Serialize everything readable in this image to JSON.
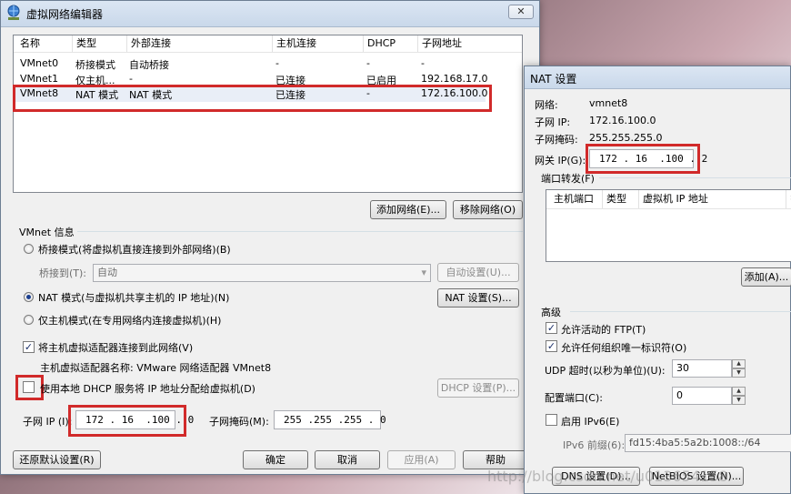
{
  "vne": {
    "title": "虚拟网络编辑器",
    "close_glyph": "✕",
    "headers": [
      "名称",
      "类型",
      "外部连接",
      "主机连接",
      "DHCP",
      "子网地址"
    ],
    "rows": [
      {
        "name": "VMnet0",
        "type": "桥接模式",
        "ext": "自动桥接",
        "host": "-",
        "dhcp": "-",
        "subnet": "-"
      },
      {
        "name": "VMnet1",
        "type": "仅主机...",
        "ext": "-",
        "host": "已连接",
        "dhcp": "已启用",
        "subnet": "192.168.17.0"
      },
      {
        "name": "VMnet8",
        "type": "NAT 模式",
        "ext": "NAT 模式",
        "host": "已连接",
        "dhcp": "-",
        "subnet": "172.16.100.0"
      }
    ],
    "add_network": "添加网络(E)...",
    "remove_network": "移除网络(O)",
    "vmnet_info": "VMnet 信息",
    "bridge_mode": "桥接模式(将虚拟机直接连接到外部网络)(B)",
    "bridge_to_label": "桥接到(T):",
    "bridge_to_value": "自动",
    "auto_settings": "自动设置(U)...",
    "nat_mode": "NAT 模式(与虚拟机共享主机的 IP 地址)(N)",
    "nat_settings": "NAT 设置(S)...",
    "host_only": "仅主机模式(在专用网络内连接虚拟机)(H)",
    "connect_adapter": "将主机虚拟适配器连接到此网络(V)",
    "adapter_name": "主机虚拟适配器名称: VMware 网络适配器 VMnet8",
    "use_dhcp": "使用本地 DHCP 服务将 IP 地址分配给虚拟机(D)",
    "dhcp_settings": "DHCP 设置(P)...",
    "subnet_ip_label": "子网 IP (I):",
    "subnet_ip": "172 . 16  .100 . 0",
    "subnet_mask_label": "子网掩码(M):",
    "subnet_mask": "255 .255 .255 . 0",
    "restore_defaults": "还原默认设置(R)",
    "ok": "确定",
    "cancel": "取消",
    "apply": "应用(A)",
    "help": "帮助"
  },
  "nat": {
    "title": "NAT 设置",
    "network_label": "网络:",
    "network_value": "vmnet8",
    "subnet_ip_label": "子网 IP:",
    "subnet_ip_value": "172.16.100.0",
    "mask_label": "子网掩码:",
    "mask_value": "255.255.255.0",
    "gateway_label": "网关 IP(G):",
    "gateway_value": "172 . 16  .100 . 2",
    "port_forward": "端口转发(F)",
    "pf_headers": [
      "主机端口",
      "类型",
      "虚拟机 IP 地址",
      "扌"
    ],
    "add": "添加(A)...",
    "advanced": "高级",
    "allow_ftp": "允许活动的 FTP(T)",
    "allow_oui": "允许任何组织唯一标识符(O)",
    "udp_timeout_label": "UDP 超时(以秒为单位)(U):",
    "udp_timeout_value": "30",
    "config_port_label": "配置端口(C):",
    "config_port_value": "0",
    "enable_ipv6": "启用 IPv6(E)",
    "ipv6_prefix_label": "IPv6 前缀(6):",
    "ipv6_prefix_value": "fd15:4ba5:5a2b:1008::/64",
    "dns_settings": "DNS 设置(D)...",
    "netbios_settings": "NetBIOS 设置(N)..."
  },
  "watermark": "http://blog.csdn.net/u013654158"
}
